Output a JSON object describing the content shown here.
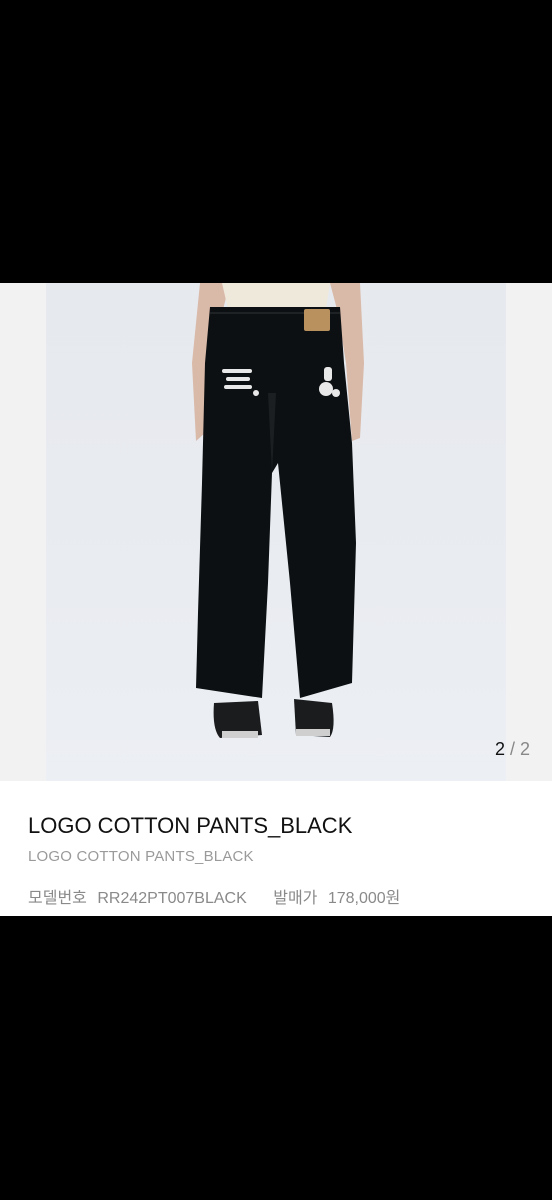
{
  "product": {
    "image_counter": {
      "current": "2",
      "separator": " / ",
      "total": "2"
    },
    "title": "LOGO COTTON PANTS_BLACK",
    "subtitle": "LOGO COTTON PANTS_BLACK",
    "model_label": "모델번호",
    "model_value": "RR242PT007BLACK",
    "price_label": "발매가",
    "price_value": "178,000원"
  },
  "colors": {
    "background": "#000000",
    "card": "#ffffff",
    "pants": "#0d1012"
  }
}
